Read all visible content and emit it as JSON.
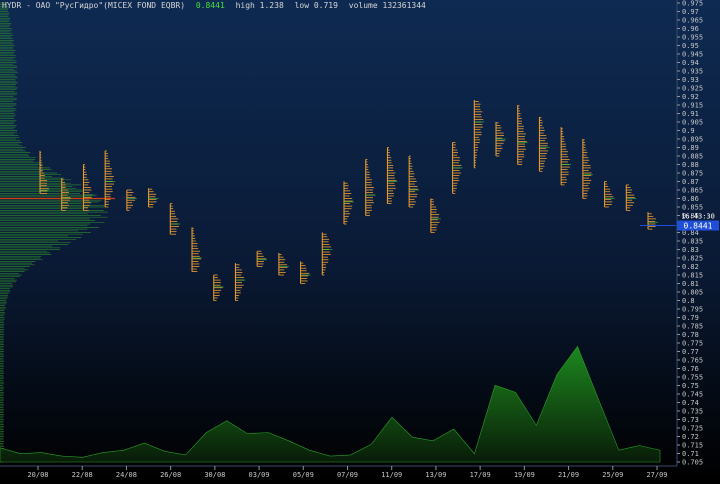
{
  "header": {
    "symbol": "HYDR - ОАО \"РусГидро\"(MICEX FOND EQBR)",
    "last": "0.8441",
    "high": "high 1.238",
    "low": "low 0.719",
    "volume": "volume 132361344"
  },
  "price_marker": {
    "value": "0.8441",
    "time": "16:43:30"
  },
  "colors": {
    "background_top": "#0e2a52",
    "background_bottom": "#000000",
    "profile_bars": "#f0a030",
    "volume_area": "#1e7a1e",
    "left_profile": "#2e8a2e",
    "poc_line": "#d04010",
    "price_marker": "#1f4fd8",
    "axis_text": "#c8c8c8"
  },
  "chart_data": {
    "type": "area",
    "title": "",
    "y_axis": {
      "min": 0.705,
      "max": 0.975,
      "step": 0.005,
      "labels": [
        "0.975",
        "0.97",
        "0.965",
        "0.96",
        "0.955",
        "0.95",
        "0.945",
        "0.94",
        "0.935",
        "0.93",
        "0.925",
        "0.92",
        "0.915",
        "0.91",
        "0.905",
        "0.9",
        "0.895",
        "0.89",
        "0.885",
        "0.88",
        "0.875",
        "0.87",
        "0.865",
        "0.86",
        "0.855",
        "0.85",
        "0.845",
        "0.84",
        "0.835",
        "0.83",
        "0.825",
        "0.82",
        "0.815",
        "0.81",
        "0.805",
        "0.8",
        "0.795",
        "0.79",
        "0.785",
        "0.78",
        "0.775",
        "0.77",
        "0.765",
        "0.76",
        "0.755",
        "0.75",
        "0.745",
        "0.74",
        "0.735",
        "0.73",
        "0.725",
        "0.72",
        "0.715",
        "0.71",
        "0.705"
      ]
    },
    "x_axis": {
      "labels": [
        "20/08",
        "22/08",
        "24/08",
        "26/08",
        "30/08",
        "03/09",
        "05/09",
        "07/09",
        "11/09",
        "13/09",
        "17/09",
        "19/09",
        "21/09",
        "25/09",
        "27/09"
      ]
    },
    "sessions": [
      {
        "low": 0.863,
        "high": 0.888,
        "poc": 0.865
      },
      {
        "low": 0.853,
        "high": 0.872,
        "poc": 0.86
      },
      {
        "low": 0.853,
        "high": 0.88,
        "poc": 0.862
      },
      {
        "low": 0.855,
        "high": 0.888,
        "poc": 0.87
      },
      {
        "low": 0.853,
        "high": 0.865,
        "poc": 0.86
      },
      {
        "low": 0.855,
        "high": 0.866,
        "poc": 0.86
      },
      {
        "low": 0.839,
        "high": 0.857,
        "poc": 0.845
      },
      {
        "low": 0.817,
        "high": 0.843,
        "poc": 0.825
      },
      {
        "low": 0.8,
        "high": 0.815,
        "poc": 0.808
      },
      {
        "low": 0.8,
        "high": 0.822,
        "poc": 0.812
      },
      {
        "low": 0.82,
        "high": 0.829,
        "poc": 0.824
      },
      {
        "low": 0.815,
        "high": 0.828,
        "poc": 0.82
      },
      {
        "low": 0.81,
        "high": 0.823,
        "poc": 0.815
      },
      {
        "low": 0.815,
        "high": 0.84,
        "poc": 0.83
      },
      {
        "low": 0.845,
        "high": 0.87,
        "poc": 0.858
      },
      {
        "low": 0.85,
        "high": 0.883,
        "poc": 0.862
      },
      {
        "low": 0.857,
        "high": 0.89,
        "poc": 0.87
      },
      {
        "low": 0.855,
        "high": 0.885,
        "poc": 0.865
      },
      {
        "low": 0.84,
        "high": 0.86,
        "poc": 0.848
      },
      {
        "low": 0.863,
        "high": 0.893,
        "poc": 0.878
      },
      {
        "low": 0.878,
        "high": 0.918,
        "poc": 0.905
      },
      {
        "low": 0.885,
        "high": 0.905,
        "poc": 0.895
      },
      {
        "low": 0.88,
        "high": 0.915,
        "poc": 0.893
      },
      {
        "low": 0.876,
        "high": 0.908,
        "poc": 0.89
      },
      {
        "low": 0.868,
        "high": 0.902,
        "poc": 0.88
      },
      {
        "low": 0.86,
        "high": 0.895,
        "poc": 0.874
      },
      {
        "low": 0.855,
        "high": 0.87,
        "poc": 0.86
      },
      {
        "low": 0.853,
        "high": 0.868,
        "poc": 0.86
      },
      {
        "low": 0.842,
        "high": 0.852,
        "poc": 0.846
      }
    ],
    "volume_profile_levels": [
      0.705,
      0.975
    ],
    "volume": {
      "series": [
        {
          "values": [
            0.12,
            0.07,
            0.08,
            0.05,
            0.04,
            0.08,
            0.1,
            0.16,
            0.09,
            0.06,
            0.25,
            0.35,
            0.24,
            0.25,
            0.18,
            0.1,
            0.05,
            0.06,
            0.15,
            0.38,
            0.21,
            0.18,
            0.28,
            0.07,
            0.65,
            0.59,
            0.31,
            0.74,
            0.98,
            0.54,
            0.1,
            0.14,
            0.1
          ]
        }
      ]
    }
  }
}
